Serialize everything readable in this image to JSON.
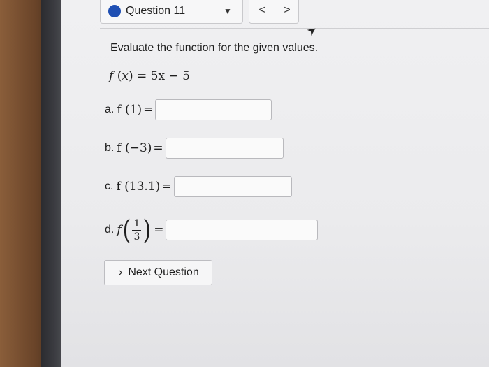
{
  "toolbar": {
    "question_label": "Question 11",
    "status_color": "#1f4fb3",
    "dropdown_icon": "caret-down-icon",
    "prev_icon": "chevron-left-icon",
    "next_icon": "chevron-right-icon",
    "prev_glyph": "<",
    "next_glyph": ">",
    "dropdown_glyph": "▼"
  },
  "question": {
    "instructions": "Evaluate the function for the given values.",
    "function": {
      "name": "f",
      "arg": "x",
      "rhs": "= 5x − 5"
    },
    "parts": [
      {
        "label": "a.",
        "expr": "f (1)",
        "equals": "=",
        "value": ""
      },
      {
        "label": "b.",
        "expr": "f (−3)",
        "equals": "=",
        "value": ""
      },
      {
        "label": "c.",
        "expr": "f (13.1)",
        "equals": "=",
        "value": ""
      },
      {
        "label": "d.",
        "expr_name": "f",
        "frac_num": "1",
        "frac_den": "3",
        "equals": "=",
        "value": ""
      }
    ]
  },
  "next_button": {
    "label": "Next Question",
    "chevron": "›"
  }
}
